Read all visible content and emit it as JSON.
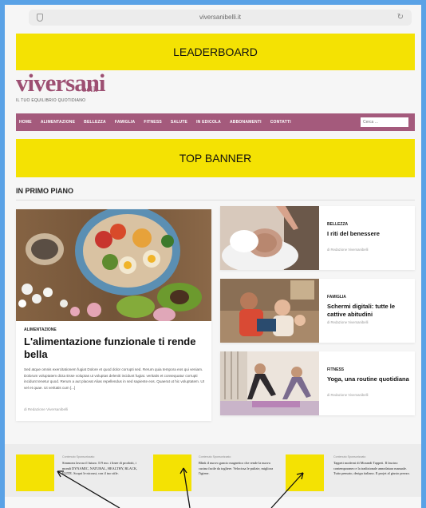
{
  "browser": {
    "url": "viversanibelli.it"
  },
  "ads": {
    "leaderboard": "LEADERBOARD",
    "top_banner": "TOP BANNER"
  },
  "site": {
    "logo_main": "viversani",
    "logo_sub": "belli",
    "tagline": "IL TUO EQUILIBRIO QUOTIDIANO"
  },
  "nav": {
    "items": [
      "HOME",
      "ALIMENTAZIONE",
      "BELLEZZA",
      "FAMIGLIA",
      "FITNESS",
      "SALUTE",
      "IN EDICOLA",
      "ABBONAMENTI",
      "CONTATTI"
    ],
    "search_placeholder": "Cerca ..."
  },
  "section": {
    "title": "IN PRIMO PIANO"
  },
  "featured": {
    "category": "ALIMENTAZIONE",
    "title": "L'alimentazione funzionale ti rende bella",
    "excerpt": "Sed atque omnis exercitationem fugiat Dolore et quod dolor corrupti sed. Rerum quia tempora eos qui veniam. Dolorum voluptatem dicta Esse voluptas ut voluptas deleniti incidunt fugiat. veritatis et consequatur corrupti incidunt tenetur quod. Rerum a aut placeat Alias repellendus in sed sapiente eos. Quaerat ut hic voluptatem. Ut vel et quae. Ut veritatis cum [...]",
    "author": "di Redazione Viversanibelli"
  },
  "side_articles": [
    {
      "category": "BELLEZZA",
      "title": "I riti del benessere",
      "author": "di Redazione Viversanibelli"
    },
    {
      "category": "FAMIGLIA",
      "title": "Schermi digitali: tutte le cattive abitudini",
      "author": "di Redazione Viversanibelli"
    },
    {
      "category": "FITNESS",
      "title": "Yoga, una routine quotidiana",
      "author": "di Redazione Viversanibelli"
    }
  ],
  "sponsored": [
    {
      "label": "Contenuto Sponsorizzato",
      "text": "Simmons lavora il futuro. Il 9 mo. i linee di prodotti, i mondi DYNAMIC, NATURAL, HEALTHY, BLACK, ELITE. Scopri le nicoust, con il tuo stile."
    },
    {
      "label": "Contenuto Sponsorizzato",
      "text": "Bltnk il nuovo gancio magnetico che rende la nuova cucina facile da togliere. Velocissa le pulizie, migliora l'igiene."
    },
    {
      "label": "Contenuto Sponsorizzato",
      "text": "Tappeti moderni di Morandi Tappeti. Il fascino contemporaneo e la tradizionale annodatura manuale. Tutto pensato, design italiano. Il projet al giusto prezzo."
    }
  ],
  "colors": {
    "accent": "#a45a7c",
    "ad_placeholder": "#f4e203",
    "frame_border": "#5aa2e6"
  }
}
